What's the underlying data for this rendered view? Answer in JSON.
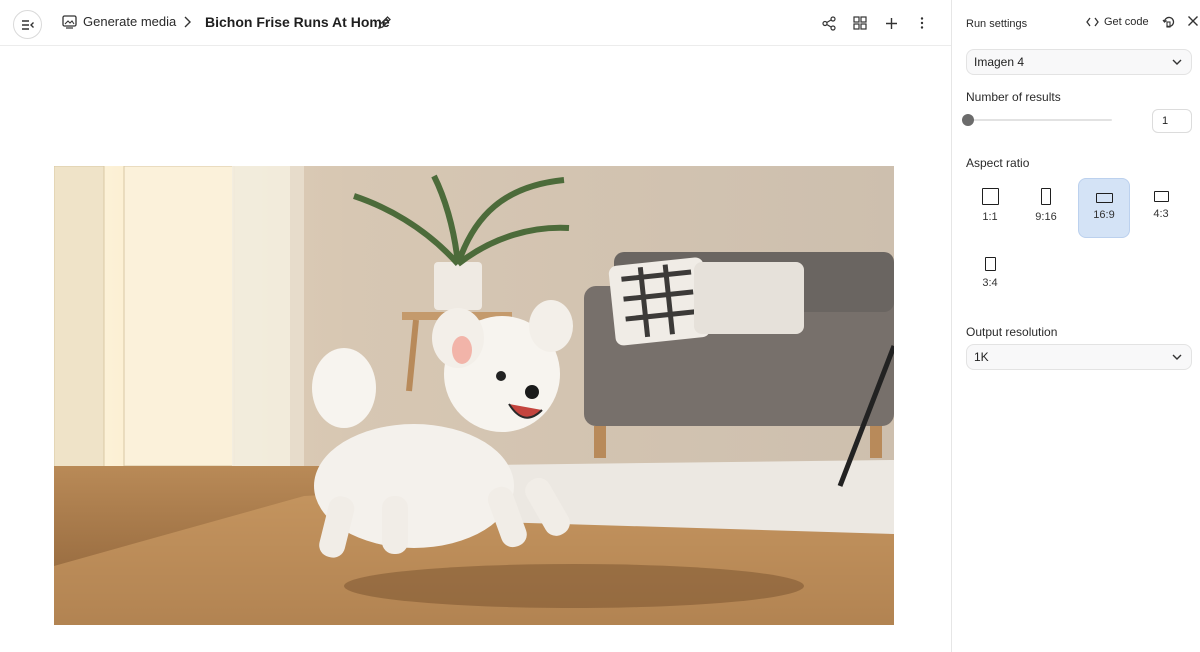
{
  "header": {
    "section_label": "Generate media",
    "title": "Bichon Frise Runs At Home"
  },
  "settings": {
    "title": "Run settings",
    "get_code_label": "Get code",
    "model": {
      "selected": "Imagen 4"
    },
    "results": {
      "label": "Number of results",
      "value": "1",
      "slider_fraction": 0
    },
    "aspect": {
      "label": "Aspect ratio",
      "options": [
        {
          "label": "1:1",
          "selected": false
        },
        {
          "label": "9:16",
          "selected": false
        },
        {
          "label": "16:9",
          "selected": true
        },
        {
          "label": "4:3",
          "selected": false
        },
        {
          "label": "3:4",
          "selected": false
        }
      ]
    },
    "resolution": {
      "label": "Output resolution",
      "selected": "1K"
    }
  },
  "colors": {
    "selected_ratio_bg": "#d4e3f6",
    "panel_border": "#e6e6e6"
  }
}
